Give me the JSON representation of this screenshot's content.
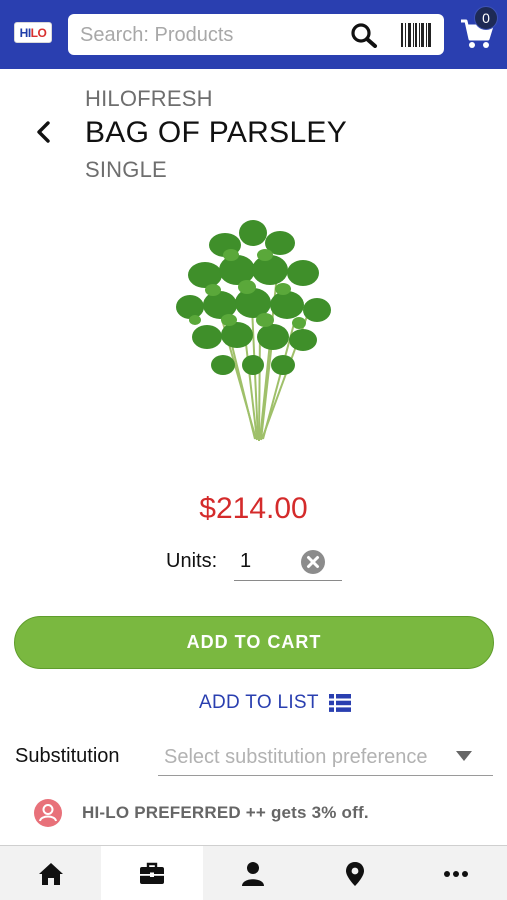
{
  "header": {
    "logo_text": "HI-LO",
    "search": {
      "placeholder": "Search: Products",
      "value": ""
    },
    "icons": [
      "search-icon",
      "barcode-icon",
      "cart-icon"
    ],
    "cart_count": "0",
    "bar_color": "#2a3fb0"
  },
  "product": {
    "brand": "HILOFRESH",
    "name": "BAG OF PARSLEY",
    "size": "SINGLE",
    "image": "parsley bunch",
    "price": "$214.00",
    "price_color": "#d42b2b"
  },
  "units": {
    "label": "Units:",
    "value": "1"
  },
  "actions": {
    "add_to_cart": "ADD TO CART",
    "add_to_cart_color": "#7ab840",
    "add_to_list": "ADD TO LIST"
  },
  "substitution": {
    "label": "Substitution",
    "placeholder": "Select substitution preference"
  },
  "promo": {
    "text": "HI-LO PREFERRED ++ gets 3% off."
  },
  "bottom_nav": {
    "items": [
      {
        "icon": "home-icon",
        "active": false
      },
      {
        "icon": "briefcase-icon",
        "active": true
      },
      {
        "icon": "user-icon",
        "active": false
      },
      {
        "icon": "location-pin-icon",
        "active": false
      },
      {
        "icon": "more-icon",
        "active": false
      }
    ]
  }
}
